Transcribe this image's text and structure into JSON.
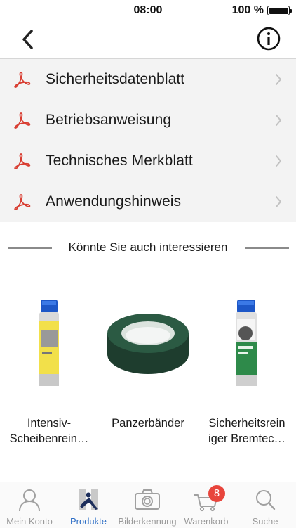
{
  "status_bar": {
    "time": "08:00",
    "battery": "100 %"
  },
  "documents": [
    {
      "label": "Sicherheitsdatenblatt"
    },
    {
      "label": "Betriebsanweisung"
    },
    {
      "label": "Technisches Merkblatt"
    },
    {
      "label": "Anwendungshinweis"
    }
  ],
  "recommendations": {
    "title": "Könnte Sie auch interessieren",
    "products": [
      {
        "line1": "Intensiv-",
        "line2": "Scheibenrein…"
      },
      {
        "line1": "Panzerbänder",
        "line2": ""
      },
      {
        "line1": "Sicherheitsrein",
        "line2": "iger Bremtec…"
      }
    ]
  },
  "tab_bar": {
    "tabs": [
      {
        "label": "Mein Konto",
        "icon": "person-icon"
      },
      {
        "label": "Produkte",
        "icon": "produkte-logo-icon"
      },
      {
        "label": "Bilderkennung",
        "icon": "camera-icon"
      },
      {
        "label": "Warenkorb",
        "icon": "cart-icon"
      },
      {
        "label": "Suche",
        "icon": "search-icon"
      }
    ],
    "cart_badge": "8"
  },
  "colors": {
    "accent": "#2e6fc6",
    "pdf_red": "#d83b2f",
    "badge": "#e8453c"
  }
}
